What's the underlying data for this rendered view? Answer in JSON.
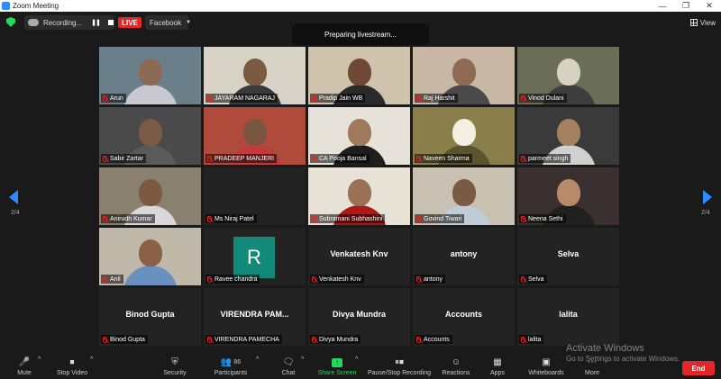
{
  "window": {
    "title": "Zoom Meeting"
  },
  "topbar": {
    "recording_label": "Recording...",
    "live_label": "LIVE",
    "stream_target": "Facebook",
    "view_label": "View"
  },
  "toast": "Preparing livestream...",
  "pagination": {
    "left": "2/4",
    "right": "2/4"
  },
  "participants": [
    {
      "name": "Arun",
      "type": "video",
      "bg": "#6b7f8a",
      "skin": "#8a6a55",
      "shirt": "#c8c8d0"
    },
    {
      "name": "JAYARAM NAGARAJ",
      "type": "video",
      "bg": "#d9d3c7",
      "skin": "#7a5a40",
      "shirt": "#3a3a3a"
    },
    {
      "name": "Pradip Jain WB",
      "type": "video",
      "bg": "#cfc3ae",
      "skin": "#6e4a35",
      "shirt": "#2a2a2a"
    },
    {
      "name": "Raj Harshit",
      "type": "video",
      "bg": "#c9b7a6",
      "skin": "#8e6a52",
      "shirt": "#4a4a4a"
    },
    {
      "name": "Vinod Dulani",
      "type": "video",
      "bg": "#6a6e58",
      "skin": "#d8d0c0",
      "shirt": "#3d3d3d"
    },
    {
      "name": "Sabir Zartar",
      "type": "video",
      "bg": "#4a4a4a",
      "skin": "#7d5a45",
      "shirt": "#5a5a5a"
    },
    {
      "name": "PRADEEP MANJERI",
      "type": "video",
      "bg": "#b04a3a",
      "skin": "#7a5640",
      "shirt": "#c23a3a"
    },
    {
      "name": "CA Pooja Bansal",
      "type": "video",
      "bg": "#e6e2da",
      "skin": "#a0785c",
      "shirt": "#1e1e1e"
    },
    {
      "name": "Naveen Sharma",
      "type": "video",
      "bg": "#8a7f4a",
      "skin": "#f2efe0",
      "shirt": "#5a5530"
    },
    {
      "name": "parmeet singh",
      "type": "video",
      "bg": "#3a3a3a",
      "skin": "#a5805e",
      "shirt": "#d0d0d0"
    },
    {
      "name": "Anirudh Kumar",
      "type": "video",
      "bg": "#8a8070",
      "skin": "#7c5a42",
      "shirt": "#d8d8d8"
    },
    {
      "name": "Ms Niraj Patel",
      "type": "blank",
      "bg": "#080808"
    },
    {
      "name": "Subramani Subhashini",
      "type": "video",
      "bg": "#e8e2d6",
      "skin": "#9a7056",
      "shirt": "#b01818"
    },
    {
      "name": "Govind Tiwari",
      "type": "video",
      "bg": "#c8c0b0",
      "skin": "#7a5a42",
      "shirt": "#c0ccd8"
    },
    {
      "name": "Neena Sethi",
      "type": "video",
      "bg": "#3a3030",
      "skin": "#b88a6a",
      "shirt": "#202020"
    },
    {
      "name": "Anil",
      "type": "video",
      "bg": "#c0b8a8",
      "skin": "#8a6048",
      "shirt": "#6a90c0"
    },
    {
      "name": "Ravee chandra",
      "type": "avatar",
      "avatar_letter": "R"
    },
    {
      "name": "Venkatesh Knv",
      "type": "text",
      "display": "Venkatesh Knv"
    },
    {
      "name": "antony",
      "type": "text",
      "display": "antony"
    },
    {
      "name": "Selva",
      "type": "text",
      "display": "Selva"
    },
    {
      "name": "Binod Gupta",
      "type": "text",
      "display": "Binod Gupta"
    },
    {
      "name": "VIRENDRA PAMECHA",
      "type": "text",
      "display": "VIRENDRA  PAM..."
    },
    {
      "name": "Divya Mundra",
      "type": "text",
      "display": "Divya Mundra"
    },
    {
      "name": "Accounts",
      "type": "text",
      "display": "Accounts"
    },
    {
      "name": "lalita",
      "type": "text",
      "display": "lalita"
    }
  ],
  "toolbar": {
    "mute": "Mute",
    "stop_video": "Stop Video",
    "security": "Security",
    "participants": "Participants",
    "participants_count": "86",
    "chat": "Chat",
    "share_screen": "Share Screen",
    "pause_recording": "Pause/Stop Recording",
    "reactions": "Reactions",
    "apps": "Apps",
    "whiteboards": "Whiteboards",
    "more": "More",
    "end": "End"
  },
  "watermark": {
    "line1": "Activate Windows",
    "line2": "Go to Settings to activate Windows."
  },
  "colors": {
    "accent": "#2d8cff",
    "live": "#e02828",
    "share": "#23d959"
  }
}
